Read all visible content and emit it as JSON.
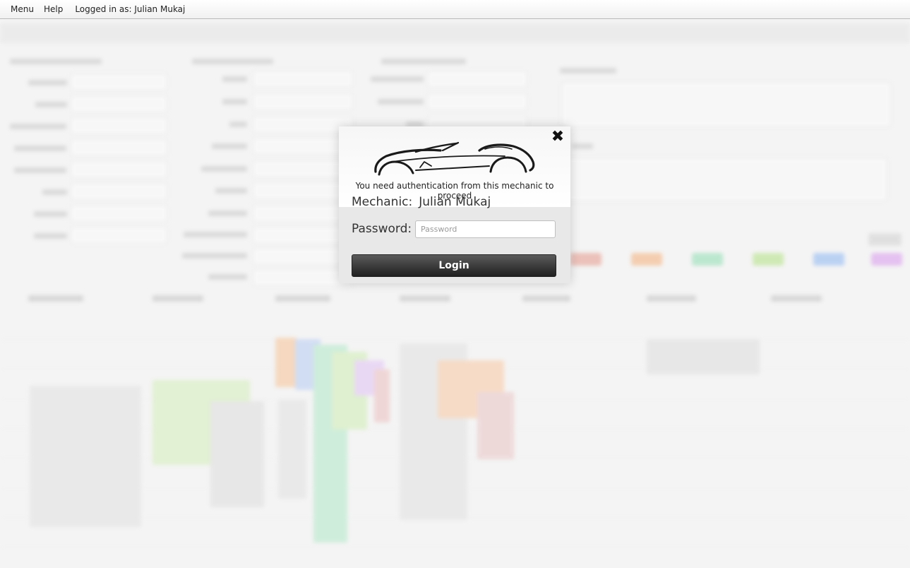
{
  "menubar": {
    "menu_label": "Menu",
    "help_label": "Help",
    "logged_in_text": "Logged in as: Julian Mukaj"
  },
  "dialog": {
    "close_icon": "close-icon",
    "logo_icon": "car-silhouette-logo",
    "notice": "You need authentication from this mechanic to proceed",
    "mechanic_label": "Mechanic:",
    "mechanic_name": "Julian Mukaj",
    "password_label": "Password:",
    "password_placeholder": "Password",
    "password_value": "",
    "login_label": "Login"
  },
  "colors": {
    "login_button": "#2e2e2e",
    "background": "#f4f4f4"
  }
}
